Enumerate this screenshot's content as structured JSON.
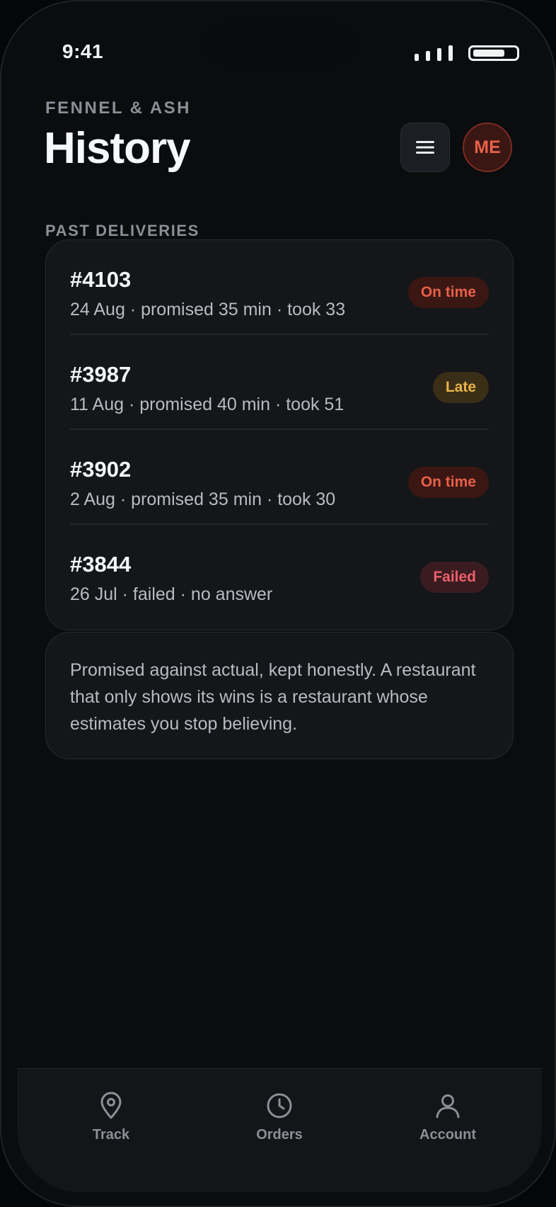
{
  "status_bar": {
    "time": "9:41"
  },
  "header": {
    "brand": "FENNEL & ASH",
    "title": "History",
    "avatar_initials": "ME"
  },
  "section_label": "PAST DELIVERIES",
  "deliveries": [
    {
      "id": "#4103",
      "meta": "24 Aug · promised 35 min · took 33",
      "status": "On time",
      "status_kind": "ontime"
    },
    {
      "id": "#3987",
      "meta": "11 Aug · promised 40 min · took 51",
      "status": "Late",
      "status_kind": "late"
    },
    {
      "id": "#3902",
      "meta": "2 Aug · promised 35 min · took 30",
      "status": "On time",
      "status_kind": "ontime"
    },
    {
      "id": "#3844",
      "meta": "26 Jul · failed · no answer",
      "status": "Failed",
      "status_kind": "failed"
    }
  ],
  "note": "Promised against actual, kept honestly. A restaurant that only shows its wins is a restaurant whose estimates you stop believing.",
  "tabs": [
    {
      "label": "Track",
      "icon": "map-pin-icon"
    },
    {
      "label": "Orders",
      "icon": "clock-icon"
    },
    {
      "label": "Account",
      "icon": "user-icon"
    }
  ],
  "colors": {
    "accent": "#e8604a",
    "ontime_text": "#e8604a",
    "ontime_bg": "#3a1713",
    "late_text": "#e9b34a",
    "late_bg": "#3a2e17",
    "failed_text": "#ea5f6d",
    "failed_bg": "#3a1c20"
  }
}
